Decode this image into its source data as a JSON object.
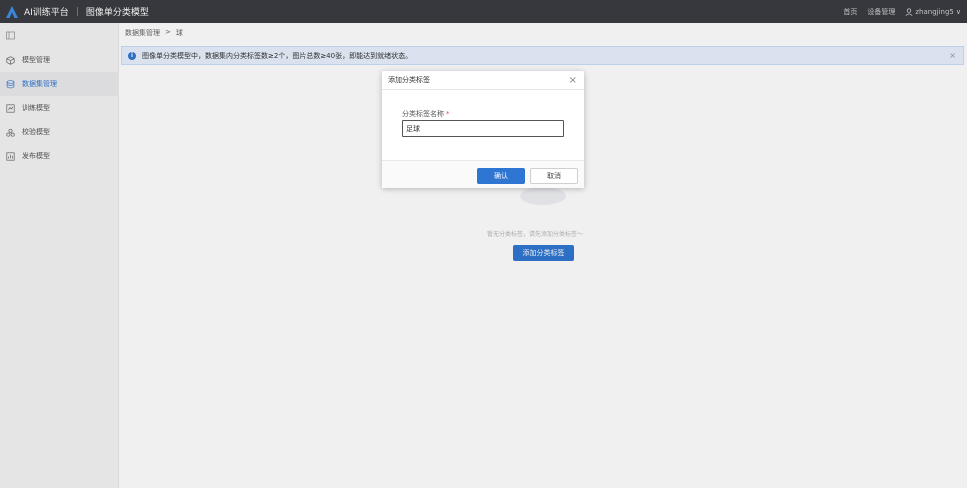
{
  "header": {
    "brand": "AI训练平台",
    "separator": "|",
    "app_title": "图像单分类模型",
    "links": [
      "首页",
      "设备管理"
    ],
    "user": "zhangjing5",
    "user_chevron": "∨"
  },
  "sidebar": {
    "items": [
      {
        "label": "模型管理",
        "icon": "cube-icon",
        "active": false
      },
      {
        "label": "数据集管理",
        "icon": "database-icon",
        "active": true
      },
      {
        "label": "训练模型",
        "icon": "train-icon",
        "active": false
      },
      {
        "label": "校验模型",
        "icon": "verify-icon",
        "active": false
      },
      {
        "label": "发布模型",
        "icon": "publish-icon",
        "active": false
      }
    ]
  },
  "breadcrumb": {
    "root": "数据集管理",
    "sep": ">",
    "current": "球"
  },
  "alert": {
    "text": "图像单分类模型中，数据集内分类标签数≥2个，图片总数≥40张，即能达到就绪状态。",
    "close": "×"
  },
  "empty_state": {
    "text": "暂无分类标签，请先添加分类标签～",
    "add_button": "添加分类标签"
  },
  "dialog": {
    "title": "添加分类标签",
    "close": "×",
    "field_label": "分类标签名称",
    "required_mark": "*",
    "field_value": "足球",
    "confirm": "确认",
    "cancel": "取消"
  },
  "colors": {
    "accent": "#2f76d2",
    "topbar": "#3a3c41"
  }
}
